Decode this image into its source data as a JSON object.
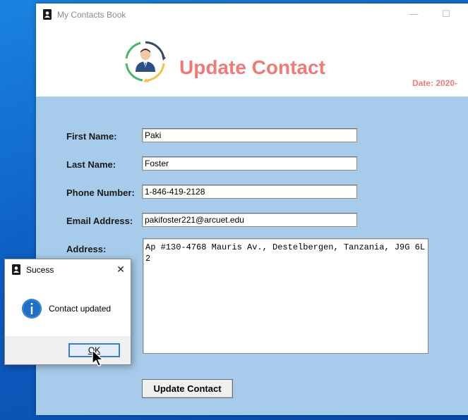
{
  "window": {
    "title": "My Contacts Book",
    "minimize_glyph": "—",
    "maximize_glyph": "☐"
  },
  "header": {
    "heading": "Update Contact",
    "date_text": "Date: 2020-",
    "accent_color": "#f07a78"
  },
  "form": {
    "first_name_label": "First Name:",
    "first_name_value": "Paki",
    "last_name_label": "Last Name:",
    "last_name_value": "Foster",
    "phone_label": "Phone Number:",
    "phone_value": "1-846-419-2128",
    "email_label": "Email Address:",
    "email_value": "pakifoster221@arcuet.edu",
    "address_label": "Address:",
    "address_value": "Ap #130-4768 Mauris Av., Destelbergen, Tanzania, J9G 6L2",
    "submit_label": "Update Contact",
    "background_color": "#a7cceb"
  },
  "dialog": {
    "title": "Sucess",
    "message": "Contact updated",
    "ok_label": "OK",
    "close_glyph": "✕",
    "info_icon": "info-icon"
  }
}
